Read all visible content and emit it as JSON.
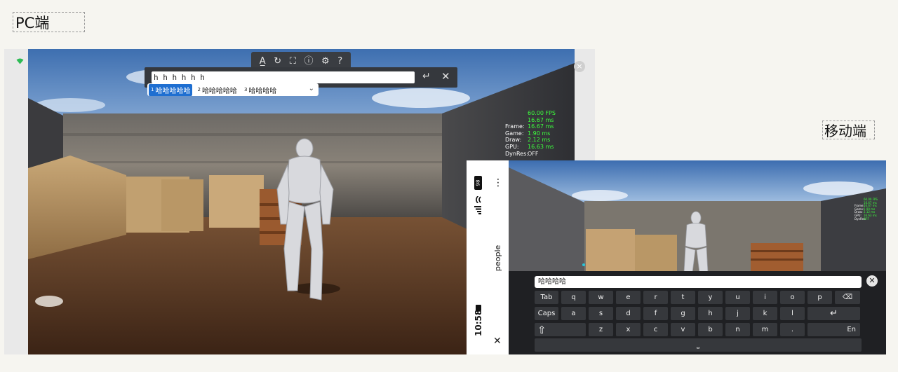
{
  "labels": {
    "pc": "PC端",
    "mobile": "移动端"
  },
  "pc": {
    "ime_input_value": "h h h h h h",
    "enter_glyph": "↵",
    "close_glyph": "✕",
    "close_round_glyph": "×",
    "toolbar_icons": [
      "text-format-icon",
      "refresh-icon",
      "fullscreen-icon",
      "info-icon",
      "settings-icon",
      "help-icon"
    ],
    "toolbar_glyphs": [
      "A̲",
      "↻",
      "⛶",
      "ⓘ",
      "⚙",
      "?"
    ],
    "candidates": [
      {
        "num": "1",
        "text": "哈哈哈哈哈",
        "active": true
      },
      {
        "num": "2",
        "text": "哈哈哈哈哈",
        "active": false
      },
      {
        "num": "3",
        "text": "哈哈哈哈",
        "active": false
      }
    ],
    "candidates_more_glyph": "⌄",
    "stats": {
      "fps": "60.00 FPS",
      "fps_ms": "16.67 ms",
      "rows": [
        {
          "key": "Frame:",
          "value": "16.67 ms"
        },
        {
          "key": "Game:",
          "value": "1.90 ms"
        },
        {
          "key": "Draw:",
          "value": "2.12 ms"
        },
        {
          "key": "GPU:",
          "value": "16.63 ms"
        },
        {
          "key": "DynRes:",
          "value": "OFF"
        }
      ]
    }
  },
  "mobile": {
    "status": {
      "time": "10:58",
      "battery": "98",
      "carrier": "people"
    },
    "more_glyph": "⋮",
    "close_glyph": "✕",
    "input_value": "哈哈哈哈",
    "clear_glyph": "✕",
    "keyboard": {
      "row1": [
        "Tab",
        "q",
        "w",
        "e",
        "r",
        "t",
        "y",
        "u",
        "i",
        "o",
        "p",
        "⌫"
      ],
      "row2": [
        "Caps",
        "a",
        "s",
        "d",
        "f",
        "g",
        "h",
        "j",
        "k",
        "l",
        "↵"
      ],
      "row3": [
        "⇧",
        "z",
        "x",
        "c",
        "v",
        "b",
        "n",
        "m",
        ".",
        "En"
      ],
      "space_glyph": "⎵"
    },
    "accent": "#26c6da"
  }
}
